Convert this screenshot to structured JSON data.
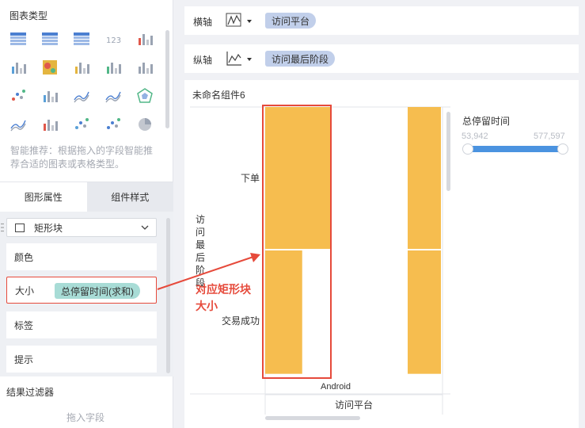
{
  "left_panel": {
    "chart_types_title": "图表类型",
    "chart_icons": [
      "table-icon",
      "crosstab-icon",
      "grouped-table-icon",
      "kpi-number-icon",
      "color-table-icon",
      "legend-list-icon",
      "heatmap-icon",
      "grouped-bar-icon",
      "bar-icon",
      "sorted-bar-icon",
      "dot-matrix-icon",
      "scatter-bars-icon",
      "multi-line-icon",
      "radar-line-icon",
      "radar-icon",
      "area-icon",
      "stacked-bar-icon",
      "scatter-icon",
      "bubble-icon",
      "pie-icon"
    ],
    "recommend_text": "智能推荐：根据拖入的字段智能推荐合适的图表或表格类型。",
    "tabs": [
      "图形属性",
      "组件样式"
    ],
    "shape_select": "矩形块",
    "props": {
      "color": "颜色",
      "size": "大小",
      "size_field": "总停留时间(求和)",
      "label": "标签",
      "tooltip": "提示"
    },
    "filter_title": "结果过滤器",
    "drop_field": "拖入字段"
  },
  "axes": {
    "x_label": "横轴",
    "x_field": "访问平台",
    "y_label": "纵轴",
    "y_field": "访问最后阶段"
  },
  "chart": {
    "title": "未命名组件6",
    "legend_title": "总停留时间",
    "legend_min": "53,942",
    "legend_max": "577,597",
    "y_axis_title": "访问最后阶段",
    "x_axis_title": "访问平台",
    "annotation_line1": "对应矩形块",
    "annotation_line2": "大小"
  },
  "chart_data": {
    "type": "heatmap",
    "title": "未命名组件6",
    "xlabel": "访问平台",
    "ylabel": "访问最后阶段",
    "categories_x": [
      "Android"
    ],
    "categories_y": [
      "下单",
      "交易成功"
    ],
    "size_legend": {
      "name": "总停留时间",
      "min": 53942,
      "max": 577597
    },
    "cells": [
      {
        "x": "Android",
        "y": "下单",
        "relative_size": 1.0
      },
      {
        "x": "Android",
        "y": "交易成功",
        "relative_size": 0.57
      }
    ],
    "colors": {
      "fill": "#f6bd4f",
      "highlight": "#e64a3b"
    }
  }
}
